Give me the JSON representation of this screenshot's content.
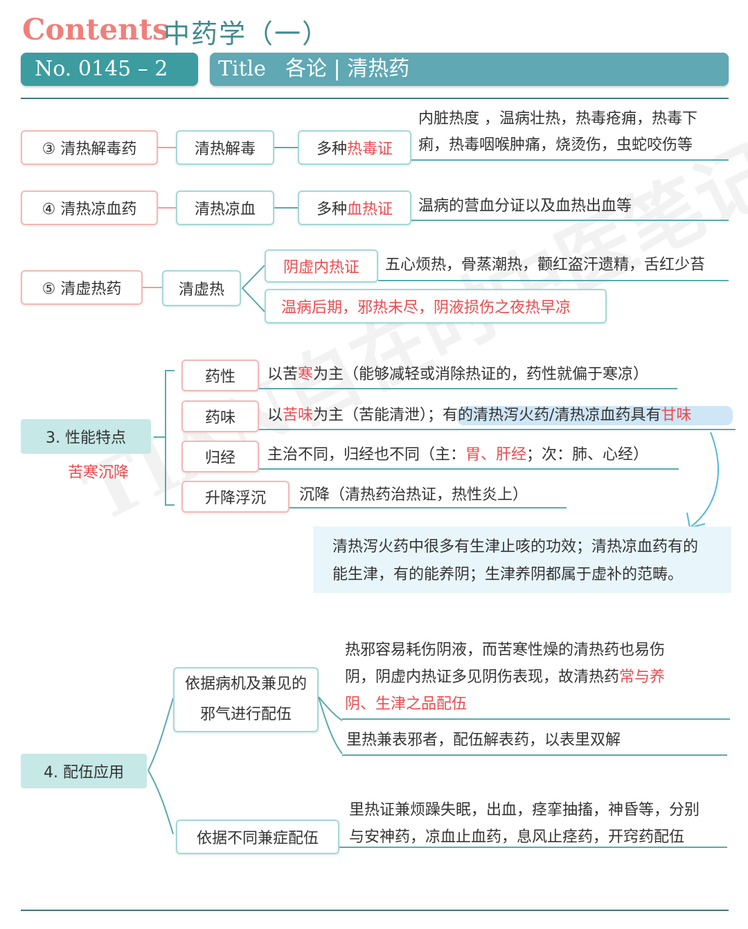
{
  "header": {
    "contents": "Contents",
    "subject": "中药学（一）",
    "no": "No. 0145 – 2",
    "title_label": "Title",
    "title": "各论 | 清热药"
  },
  "categories": {
    "c3": {
      "name": "③ 清热解毒药",
      "effect": "清热解毒",
      "syndrome_pre": "多种",
      "syndrome_hl": "热毒证",
      "desc_line1": "内脏热度 ，温病壮热，热毒疮痈，热毒下",
      "desc_line2": "痢，热毒咽喉肿痛，烧烫伤，虫蛇咬伤等"
    },
    "c4": {
      "name": "④ 清热凉血药",
      "effect": "清热凉血",
      "syndrome_pre": "多种",
      "syndrome_hl": "血热证",
      "desc": "温病的营血分证以及血热出血等"
    },
    "c5": {
      "name": "⑤ 清虚热药",
      "effect": "清虚热",
      "branch1": "阴虚内热证",
      "branch1_desc": "五心烦热，骨蒸潮热，颧红盗汗遗精，舌红少苔",
      "branch2": "温病后期，邪热未尽，阴液损伤之夜热早凉"
    }
  },
  "section3": {
    "title": "3.  性能特点",
    "subtitle": "苦寒沉降",
    "rows": {
      "r1": {
        "label": "药性",
        "t1": "以苦",
        "hl": "寒",
        "t2": "为主（能够减轻或消除热证的，药性就偏于寒凉）"
      },
      "r2": {
        "label": "药味",
        "t1": "以",
        "hl": "苦味",
        "t2": "为主（苦能清泄）；",
        "t3": "有的清热泻火药/清热凉血药具有",
        "hl2": "甘味"
      },
      "r3": {
        "label": "归经",
        "t1": "主治不同，归经也不同（主：",
        "hl": "胃、肝经",
        "t2": "；次：肺、心经）"
      },
      "r4": {
        "label": "升降浮沉",
        "t1": "沉降（清热药治热证，热性炎上）"
      }
    },
    "note_line1": "清热泻火药中很多有生津止咳的功效；清热凉血药有的",
    "note_line2": "能生津，有的能养阴；生津养阴都属于虚补的范畴。"
  },
  "section4": {
    "title": "4.  配伍应用",
    "branch1_line1": "依据病机及兼见的",
    "branch1_line2": "邪气进行配伍",
    "b1_desc1_l1": "热邪容易耗伤阴液，而苦寒性燥的清热药也易伤",
    "b1_desc1_l2": "阴，阴虚内热证多见阴伤表现，故清热药",
    "b1_desc1_hl1": "常与养",
    "b1_desc1_hl2": "阴、生津之品配伍",
    "b1_desc2": "里热兼表邪者，配伍解表药，以表里双解",
    "branch2": "依据不同兼症配伍",
    "b2_desc_l1": "里热证兼烦躁失眠，出血，痉挛抽搐，神昏等，分别",
    "b2_desc_l2": "与安神药，凉血止血药，息风止痉药，开窍药配伍"
  },
  "watermark": "TIAN自在时中医笔记",
  "colors": {
    "teal": "#3c9ca0",
    "red": "#ee4a4e",
    "coral": "#f07f7b",
    "light_teal": "#c6e8e7"
  }
}
